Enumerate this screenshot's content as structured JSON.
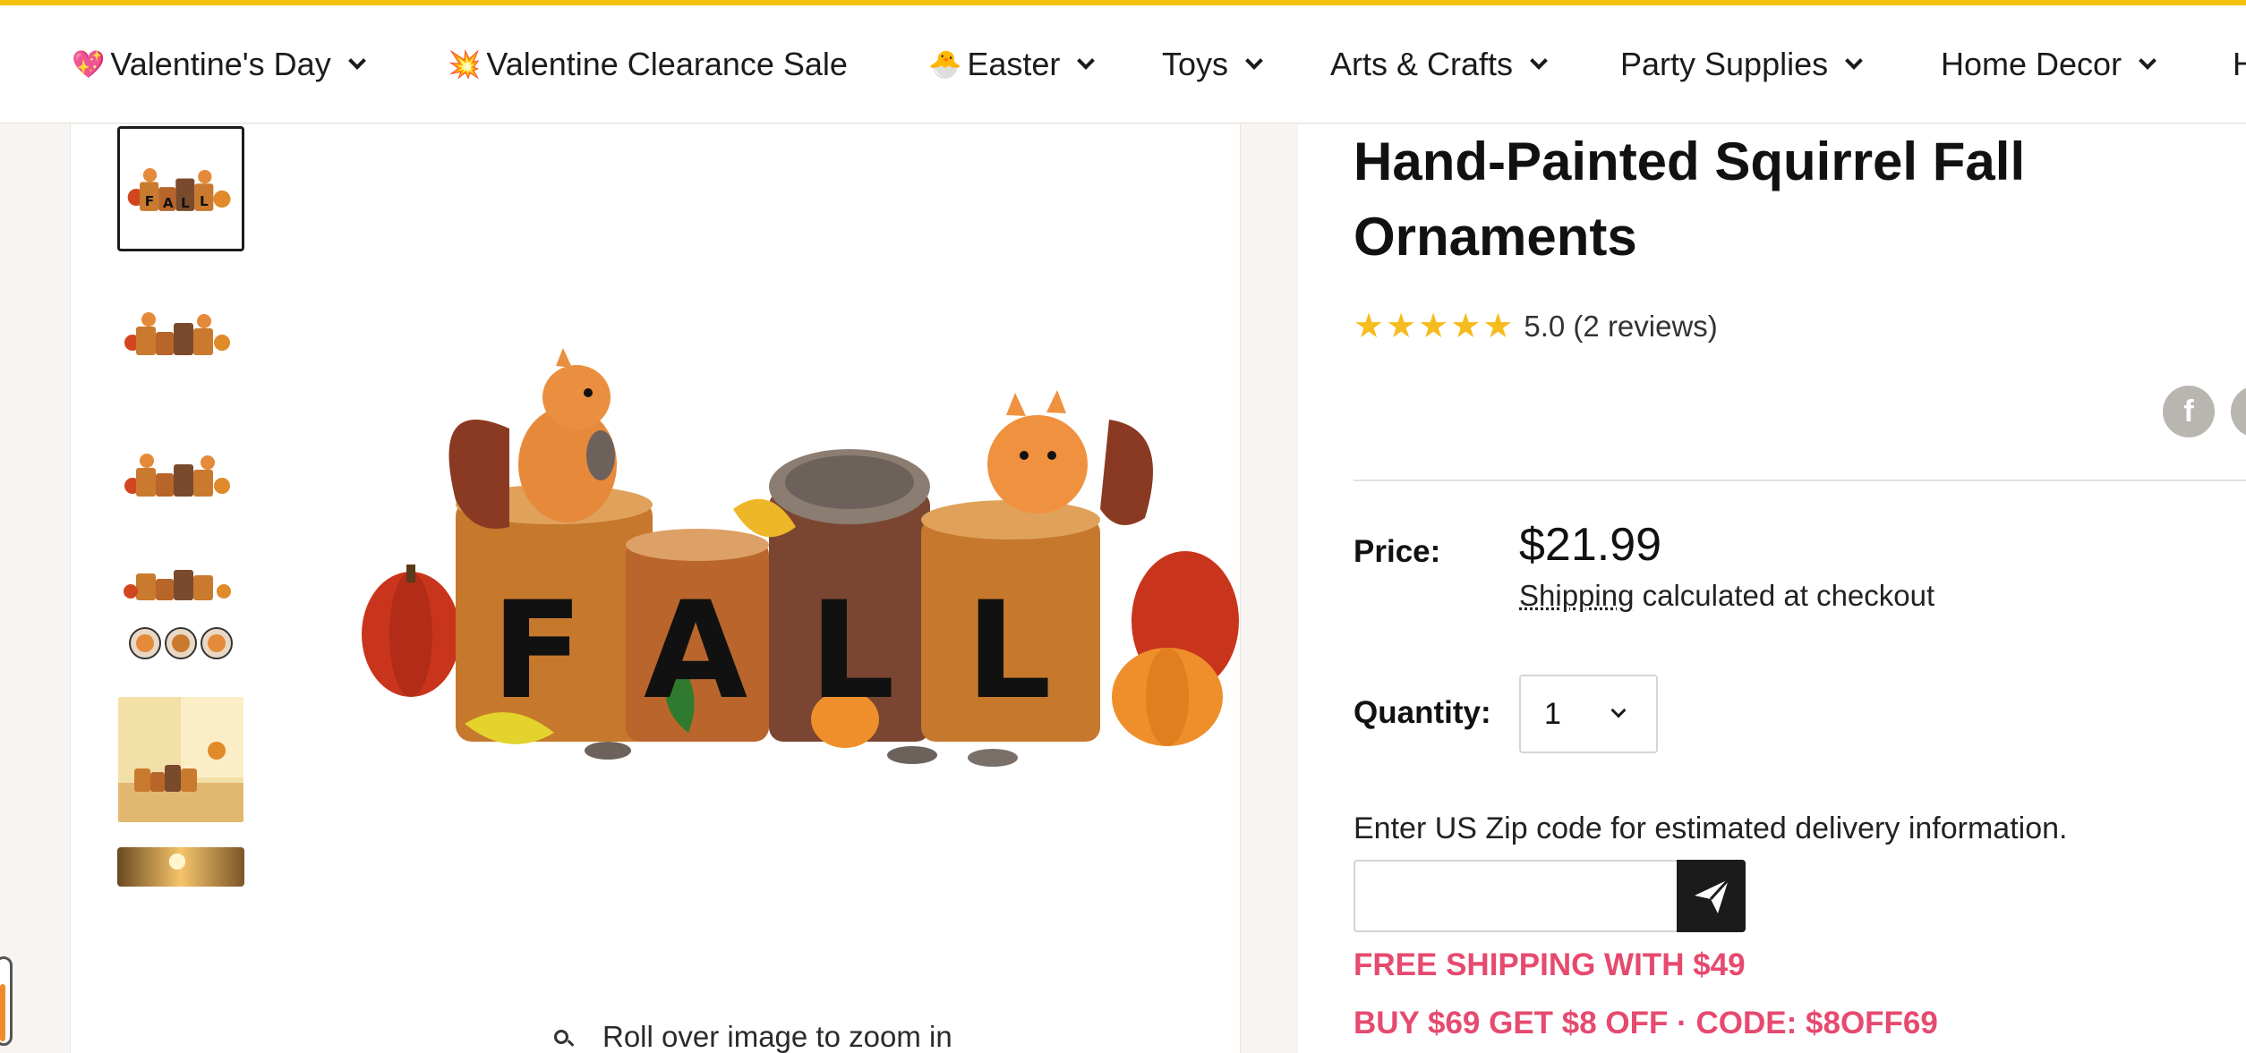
{
  "nav": {
    "items": [
      {
        "label": "Valentine's Day",
        "emoji": "💖",
        "has_dropdown": true
      },
      {
        "label": "Valentine Clearance Sale",
        "emoji": "💥",
        "has_dropdown": false
      },
      {
        "label": "Easter",
        "emoji": "🐣",
        "has_dropdown": true
      },
      {
        "label": "Toys",
        "emoji": "",
        "has_dropdown": true
      },
      {
        "label": "Arts & Crafts",
        "emoji": "",
        "has_dropdown": true
      },
      {
        "label": "Party Supplies",
        "emoji": "",
        "has_dropdown": true
      },
      {
        "label": "Home Decor",
        "emoji": "",
        "has_dropdown": true
      }
    ]
  },
  "gallery": {
    "main_word": "FALL",
    "thumb_letters": [
      "F",
      "A",
      "L",
      "L"
    ],
    "zoom_hint": "Roll over image to zoom in"
  },
  "product": {
    "title": "Hand-Painted Squirrel Fall Ornaments",
    "rating_value": 5.0,
    "rating_text": "5.0 (2 reviews)",
    "share_fb": "f",
    "price_label": "Price:",
    "price": "$21.99",
    "shipping_link": "Shipping",
    "shipping_rest": " calculated at checkout",
    "quantity_label": "Quantity:",
    "quantity_value": "1",
    "zip_label": "Enter US Zip code for estimated delivery information.",
    "zip_value": "",
    "promo_1": "FREE SHIPPING WITH $49",
    "promo_2": "BUY $69 GET $8 OFF · CODE: $8OFF69"
  },
  "colors": {
    "accent_top": "#f4c20d",
    "promo": "#e64a6f",
    "star": "#f6bb1d"
  }
}
